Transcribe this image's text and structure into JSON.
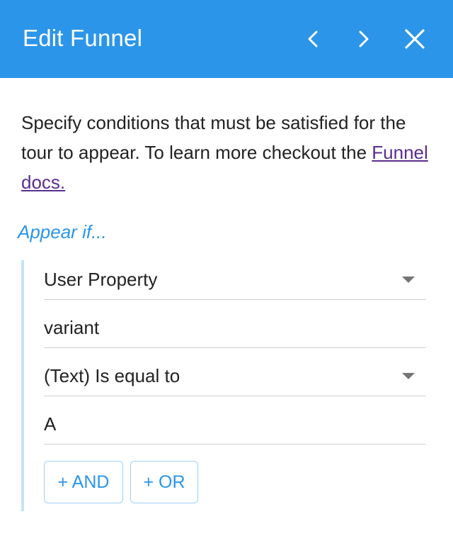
{
  "header": {
    "title": "Edit Funnel",
    "prev_icon": "chevron-left-icon",
    "next_icon": "chevron-right-icon",
    "close_icon": "close-icon",
    "background_color": "#2b95e9"
  },
  "description": {
    "text": "Specify conditions that must be satisfied for the tour to appear. To learn more checkout the ",
    "link_text": "Funnel docs."
  },
  "condition": {
    "label": "Appear if...",
    "property_type": "User Property",
    "property_name": "variant",
    "operator": "(Text) Is equal to",
    "value": "A",
    "and_label": "+ AND",
    "or_label": "+ OR"
  },
  "colors": {
    "accent": "#2b95e9",
    "link": "#5a2d91",
    "group_border": "#c5e2f7"
  }
}
